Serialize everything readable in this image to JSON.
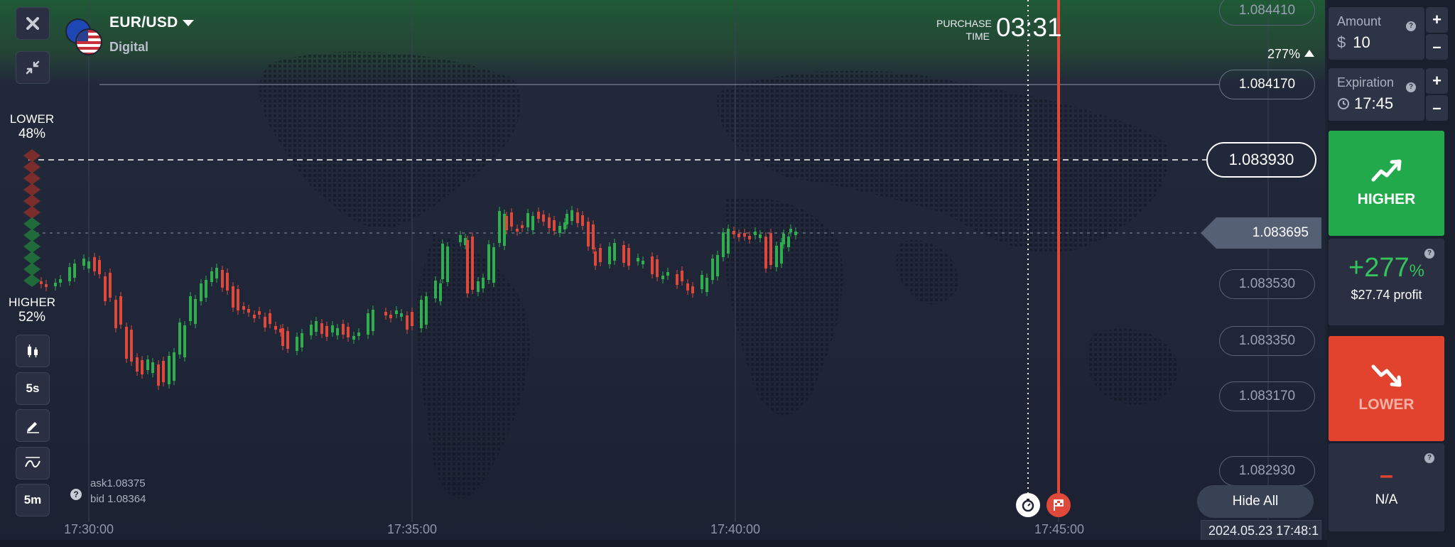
{
  "asset": {
    "name": "EUR/USD",
    "type": "Digital"
  },
  "purchase": {
    "label": "PURCHASE\nTIME",
    "time": "03:31"
  },
  "top_percent": "277%",
  "sentiment": {
    "lower_label": "LOWER",
    "lower_value": "48%",
    "higher_label": "HIGHER",
    "higher_value": "52%"
  },
  "toolbar": {
    "timeframe": "5s",
    "interval": "5m"
  },
  "price_levels": [
    "1.084410",
    "1.084170",
    "1.083930",
    "1.083530",
    "1.083350",
    "1.083170",
    "1.082930"
  ],
  "current_price": "1.083695",
  "quote": {
    "ask": "ask1.08375",
    "bid": "bid 1.08364"
  },
  "time_axis": [
    "17:30:00",
    "17:35:00",
    "17:40:00",
    "17:45:00"
  ],
  "hide_all": "Hide All",
  "datetime": "2024.05.23 17:48:1",
  "amount": {
    "label": "Amount",
    "currency": "$",
    "value": "10"
  },
  "expiration": {
    "label": "Expiration",
    "value": "17:45"
  },
  "higher_button": "HIGHER",
  "profit": {
    "percent": "+277",
    "percent_sign": "%",
    "amount": "$27.74 profit"
  },
  "lower_button": "LOWER",
  "lower_profit": {
    "dash": "–",
    "text": "N/A"
  },
  "colors": {
    "up": "#2fae4e",
    "down": "#e0483a",
    "higher_bg": "#22a94b",
    "lower_bg": "#e1432f",
    "expiry_line": "#e0483a"
  },
  "icons": [
    "close-icon",
    "collapse-icon",
    "candles-icon",
    "pencil-icon",
    "indicator-icon",
    "help-icon",
    "stopwatch-icon",
    "finish-flag-icon",
    "chart-up-icon",
    "chart-down-icon",
    "clock-icon"
  ]
}
